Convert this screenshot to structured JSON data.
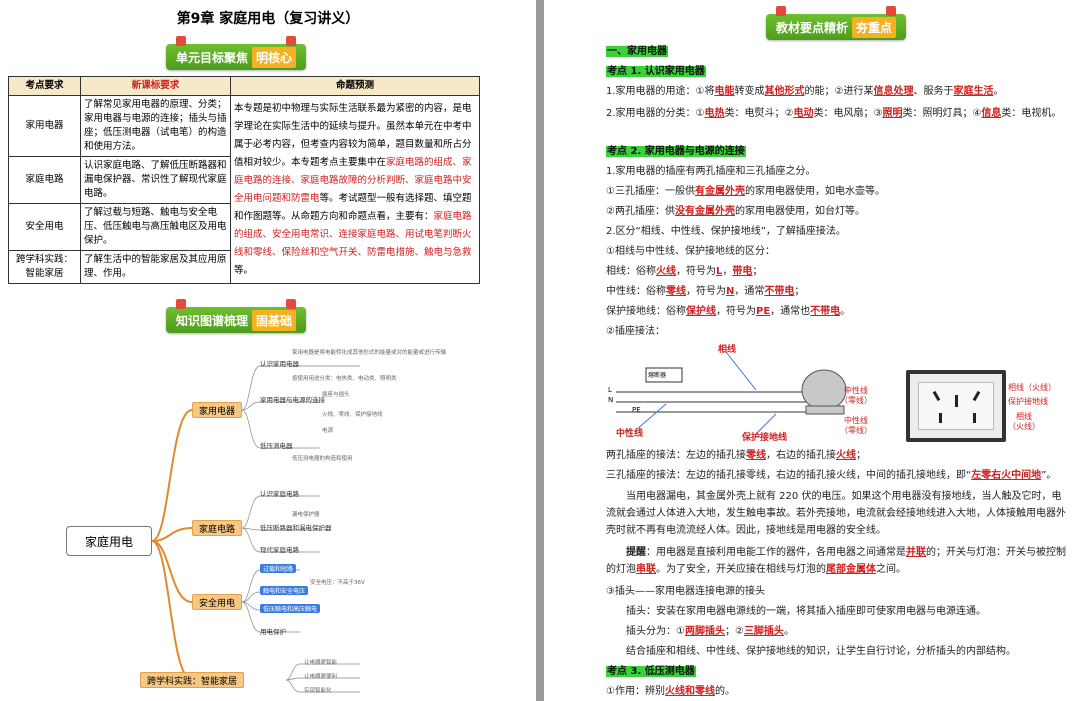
{
  "left": {
    "title": "第9章 家庭用电（复习讲义）",
    "banner1": {
      "main": "单元目标聚焦",
      "accent": "明核心"
    },
    "banner2": {
      "main": "知识图谱梳理",
      "accent": "固基础"
    },
    "table": {
      "headers": [
        "考点要求",
        "新课标要求",
        "命题预测"
      ],
      "rows": [
        {
          "topic": "家用电器",
          "req": "了解常见家用电器的原理、分类；家用电器与电源的连接；插头与插座；低压测电器（试电笔）的构造和使用方法。"
        },
        {
          "topic": "家庭电路",
          "req": "认识家庭电路、了解低压断路器和漏电保护器、常识性了解现代家庭电路。"
        },
        {
          "topic": "安全用电",
          "req": "了解过载与短路、触电与安全电压、低压触电与高压触电区及用电保护。"
        },
        {
          "topic": "跨学科实践：智能家居",
          "req": "了解生活中的智能家居及其应用原理、作用。"
        }
      ],
      "prediction_plain1": "本专题是初中物理与实际生活联系最为紧密的内容，是电学理论在实际生活中的延续与提升。虽然本单元在中考中属于必考内容，但考查内容较为简单，题目数量和所占分值相对较少。本专题考点主要集中在",
      "prediction_red1": "家庭电路的组成、家庭电路的连接、家庭电路故障的分析判断、家庭电路中安全用电问题和防雷电",
      "prediction_plain2": "等。考试题型一般有选择题、填空题和作图题等。从命题方向和命题点看，主要有：",
      "prediction_red2": "家庭电路的组成、安全用电常识、连接家庭电路、用试电笔判断火线和零线、保险丝和空气开关、防雷电措施、触电与急救",
      "prediction_end": "等。"
    },
    "mindmap": {
      "root": "家庭用电",
      "branches": [
        "家用电器",
        "家庭电路",
        "安全用电",
        "跨学科实践：智能家居"
      ],
      "subs": [
        "认识家用电器",
        "家用电器与电源的连接",
        "低压测电器",
        "认识家庭电路",
        "低压断路器和漏电保护器",
        "现代家庭电路",
        "触电和安全电压",
        "低压触电和高压触电",
        "用电保护",
        "过载和短路"
      ],
      "leaves": [
        "家用电器是将电能转化成其他形式的能量或对的能量或进行传输",
        "按使用用途分类：电热类、电动类、照明类",
        "插座与插头",
        "火线、零线、保护接地线",
        "电源",
        "低压测电器的构造和使用",
        "漏电保护器",
        "安全电压：不高于36V",
        "让电器更智能",
        "让电器更便利",
        "实现智能化"
      ]
    }
  },
  "right": {
    "banner": {
      "main": "教材要点精析",
      "accent": "夯重点"
    },
    "sec1": "一、家用电器",
    "k1": "考点 1. 认识家用电器",
    "p1_a": "1.家用电器的用途：①将",
    "p1_r1": "电能",
    "p1_b": "转变成",
    "p1_r2": "其他形式",
    "p1_c": "的能；②进行某",
    "p1_r3": "信息处理",
    "p1_d": "、服务于",
    "p1_r4": "家庭生活",
    "p1_e": "。",
    "p2_a": "2.家用电器的分类：①",
    "p2_r1": "电热",
    "p2_b": "类：电熨斗；②",
    "p2_r2": "电动",
    "p2_c": "类：电风扇；③",
    "p2_r3": "照明",
    "p2_d": "类：照明灯具；④",
    "p2_r4": "信息",
    "p2_e": "类：电视机。",
    "k2": "考点 2. 家用电器与电源的连接",
    "p3": "1.家用电器的插座有两孔插座和三孔插座之分。",
    "p4_a": "①三孔插座：一般供",
    "p4_r": "有金属外壳",
    "p4_b": "的家用电器使用，如电水壶等。",
    "p5_a": "②两孔插座：供",
    "p5_r": "没有金属外壳",
    "p5_b": "的家用电器使用，如台灯等。",
    "p6": "2.区分“相线、中性线、保护接地线”，了解插座接法。",
    "p7": "①相线与中性线、保护接地线的区分：",
    "p8_a": "相线：俗称",
    "p8_r1": "火线",
    "p8_b": "，符号为",
    "p8_s": "L",
    "p8_c": "，",
    "p8_r2": "带电",
    "p8_d": "；",
    "p9_a": "中性线：俗称",
    "p9_r1": "零线",
    "p9_b": "，符号为",
    "p9_s": "N",
    "p9_c": "，通常",
    "p9_r2": "不带电",
    "p9_d": "；",
    "p10_a": "保护接地线：俗称",
    "p10_r1": "保护线",
    "p10_b": "，符号为",
    "p10_s": "PE",
    "p10_c": "，通常也",
    "p10_r2": "不带电",
    "p10_d": "。",
    "p11": "②插座接法：",
    "diagram": {
      "xiangxian": "相线",
      "zhongxing": "中性线",
      "baohu": "保护接地线",
      "breaker": "熔断器",
      "L": "L",
      "N": "N",
      "PE": "PE",
      "s_zx1": "中性线",
      "s_zx1b": "（零线）",
      "s_zx2": "中性线",
      "s_zx2b": "（零线）",
      "s_hx1": "相线（火线）",
      "s_bh": "保护接地线",
      "s_hx2": "相线",
      "s_hx2b": "（火线）"
    },
    "p12_a": "两孔插座的接法：左边的插孔接",
    "p12_r1": "零线",
    "p12_b": "，右边的插孔接",
    "p12_r2": "火线",
    "p12_c": "；",
    "p13_a": "三孔插座的接法：左边的插孔接零线，右边的插孔接火线，中间的插孔接地线，即“",
    "p13_r": "左零右火中间地",
    "p13_b": "”。",
    "p14": "当用电器漏电，其金属外壳上就有 220 伏的电压。如果这个用电器没有接地线，当人触及它时，电流就会通过人体进入大地，发生触电事故。若外壳接地，电流就会经接地线进入大地，人体接触用电器外壳时就不再有电流流经人体。因此，接地线是用电器的安全线。",
    "p15_a": "提醒",
    "p15_b": "：用电器是直接利用电能工作的器件，各用电器之间通常是",
    "p15_r1": "并联",
    "p15_c": "的；开关与灯泡：开关与被控制的灯泡",
    "p15_r2": "串联",
    "p15_d": "。为了安全，开关应接在相线与灯泡的",
    "p15_r3": "尾部金属体",
    "p15_e": "之间。",
    "p16": "③插头——家用电器连接电源的接头",
    "p17": "插头：安装在家用电器电源线的一端，将其插入插座即可使家用电器与电源连通。",
    "p18_a": "插头分为：①",
    "p18_r1": "两脚插头",
    "p18_b": "；②",
    "p18_r2": "三脚插头",
    "p18_c": "。",
    "p19": "结合插座和相线、中性线、保护接地线的知识，让学生自行讨论，分析插头的内部结构。",
    "k3": "考点 3. 低压测电器",
    "p20_a": "①作用：辨别",
    "p20_r": "火线和零线",
    "p20_b": "的。"
  },
  "colors": {
    "accent_green": "#4e9c1e",
    "highlight": "#3bd13b",
    "red": "#d02020",
    "banner_accent": "#f4b223"
  }
}
